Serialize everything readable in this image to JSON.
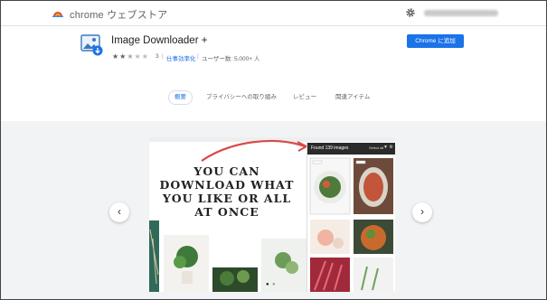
{
  "header": {
    "store_name": "chrome ウェブストア",
    "account_icon": "gear-icon",
    "account_email_blurred": true
  },
  "item": {
    "title": "Image Downloader +",
    "rating": 2.5,
    "rating_count": "3",
    "category": "仕事効率化",
    "users": "ユーザー数: 5,000+ 人",
    "add_button": "Chrome に追加",
    "accent": "#1a73e8"
  },
  "tabs": [
    {
      "label": "概要",
      "active": true
    },
    {
      "label": "プライバシーへの取り組み",
      "active": false
    },
    {
      "label": "レビュー",
      "active": false
    },
    {
      "label": "関連アイテム",
      "active": false
    }
  ],
  "gallery": {
    "headline": "YOU CAN DOWNLOAD WHAT YOU LIKE OR ALL AT ONCE",
    "ext_found": "Found 139 images",
    "ext_select_all": "Select all",
    "prev_icon": "chevron-left-icon",
    "next_icon": "chevron-right-icon",
    "slide_count": 2,
    "active_slide": 1
  }
}
